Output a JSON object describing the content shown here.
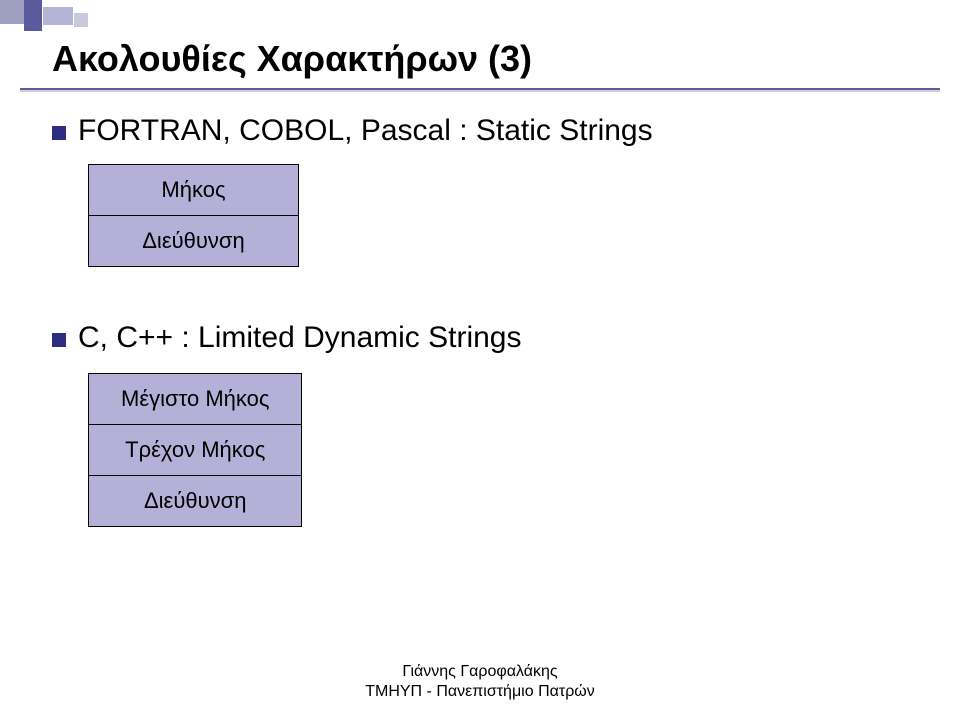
{
  "title": "Ακολουθίες Χαρακτήρων (3)",
  "sections": [
    {
      "label": "FORTRAN, COBOL, Pascal : Static Strings",
      "cells": [
        "Μήκος",
        "Διεύθυνση"
      ]
    },
    {
      "label": "C, C++ : Limited Dynamic Strings",
      "cells": [
        "Μέγιστο Μήκος",
        "Τρέχον Μήκος",
        "Διεύθυνση"
      ]
    }
  ],
  "footer": {
    "line1": "Γιάννης Γαροφαλάκης",
    "line2": "ΤΜΗΥΠ - Πανεπιστήμιο Πατρών"
  }
}
